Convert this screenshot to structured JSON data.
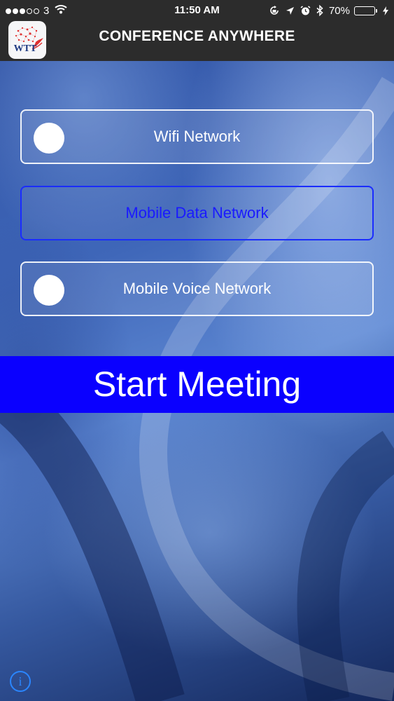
{
  "status_bar": {
    "signal_dots_filled": 3,
    "signal_dots_total": 5,
    "carrier": "3",
    "time": "11:50 AM",
    "battery_percent": "70%",
    "battery_level": 0.7
  },
  "header": {
    "logo_text": "WTT",
    "title": "CONFERENCE ANYWHERE"
  },
  "network_options": [
    {
      "label": "Wifi Network",
      "selected": false
    },
    {
      "label": "Mobile Data Network",
      "selected": true
    },
    {
      "label": "Mobile Voice Network",
      "selected": false
    }
  ],
  "start_button": {
    "label": "Start Meeting"
  },
  "info_button": {
    "label": "i"
  },
  "colors": {
    "bar_background": "#2c2c2c",
    "start_button": "#0a00ff",
    "selected_border": "#1a2cff",
    "info_icon": "#2a86ff",
    "battery_fill": "#3ad15a"
  }
}
